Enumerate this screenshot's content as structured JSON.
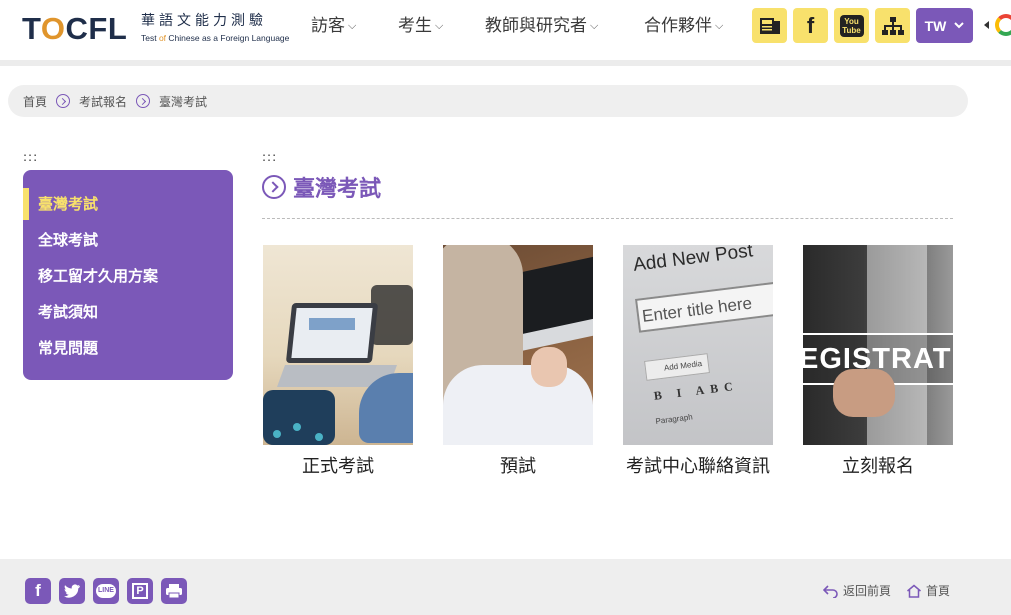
{
  "header": {
    "logo_word": "TOCFL",
    "logo_cn": "華語文能力測驗",
    "logo_en_pre": "Test ",
    "logo_en_of": "of",
    "logo_en_post": " Chinese as a Foreign Language",
    "nav": [
      {
        "label": "訪客"
      },
      {
        "label": "考生"
      },
      {
        "label": "教師與研究者"
      },
      {
        "label": "合作夥伴"
      }
    ],
    "youtube_label": "You Tube",
    "facebook_label": "f",
    "language": "TW"
  },
  "breadcrumb": [
    "首頁",
    "考試報名",
    "臺灣考試"
  ],
  "accesskey": ":::",
  "sidebar": {
    "items": [
      {
        "label": "臺灣考試",
        "active": true
      },
      {
        "label": "全球考試",
        "active": false
      },
      {
        "label": "移工留才久用方案",
        "active": false
      },
      {
        "label": "考試須知",
        "active": false
      },
      {
        "label": "常見問題",
        "active": false
      }
    ]
  },
  "main": {
    "title": "臺灣考試",
    "cards": [
      {
        "caption": "正式考試"
      },
      {
        "caption": "預試"
      },
      {
        "caption": "考試中心聯絡資訊"
      },
      {
        "caption": "立刻報名"
      }
    ],
    "card3_image_text": {
      "heading": "Add New Post",
      "field": "Enter title here",
      "media": "Add Media",
      "toolbar": "B I ABC",
      "paragraph": "Paragraph"
    },
    "card4_image_text": "EGISTRATIO"
  },
  "footer": {
    "share": [
      {
        "label": "f"
      },
      {
        "label": "t"
      },
      {
        "label": "LINE"
      },
      {
        "label": "P"
      },
      {
        "label": "print"
      }
    ],
    "back_label": "返回前頁",
    "home_label": "首頁"
  },
  "colors": {
    "accent_purple": "#7b58b8",
    "accent_yellow": "#f8e16c",
    "logo_navy": "#1f2e4a",
    "logo_orange": "#e0952c"
  }
}
